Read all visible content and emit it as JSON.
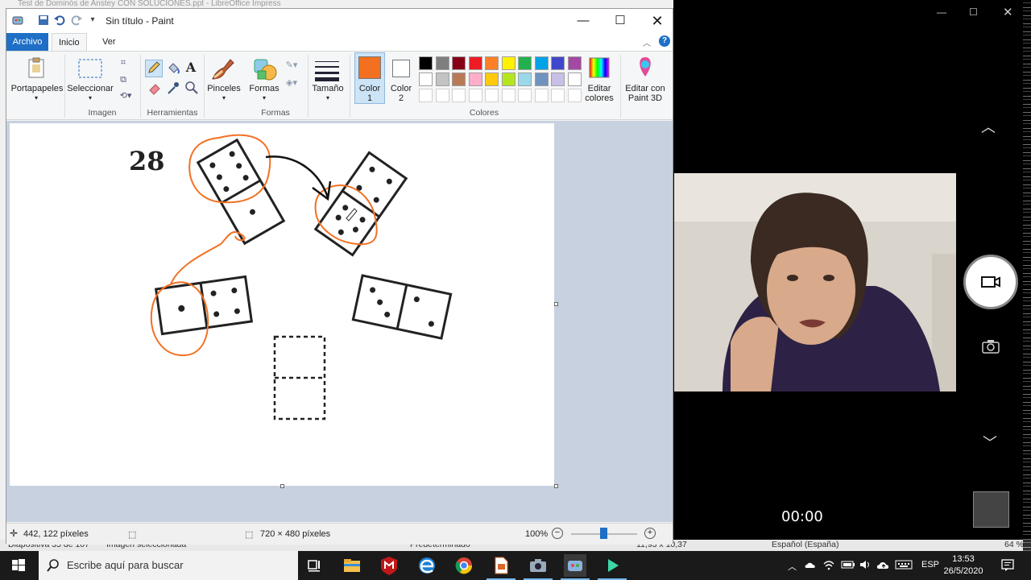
{
  "background": {
    "title": "Test de Dominós de Anstey CON SOLUCIONES.ppt - LibreOffice Impress",
    "status": {
      "slide": "Diapositiva 35 de 107",
      "selection": "Imagen seleccionada",
      "default": "Predeterminado",
      "coords": "11,93 x 10,37",
      "lang": "Español (España)",
      "zoom": "64 %"
    }
  },
  "paint": {
    "title": "Sin título - Paint",
    "tabs": {
      "file": "Archivo",
      "home": "Inicio",
      "view": "Ver"
    },
    "groups": {
      "clipboard": "Portapapeles",
      "select": "Seleccionar",
      "image": "Imagen",
      "tools": "Herramientas",
      "brushes": "Pinceles",
      "shapes": "Formas",
      "size": "Tamaño",
      "color1": [
        "Color",
        "1"
      ],
      "color2": [
        "Color",
        "2"
      ],
      "edit_colors": [
        "Editar",
        "colores"
      ],
      "paint3d": [
        "Editar con",
        "Paint 3D"
      ],
      "colors": "Colores",
      "shapes_group": "Formas"
    },
    "color1_value": "#f37021",
    "color2_value": "#ffffff",
    "palette_row1": [
      "#000000",
      "#7f7f7f",
      "#880015",
      "#ed1c24",
      "#ff7f27",
      "#fff200",
      "#22b14c",
      "#00a2e8",
      "#3f48cc",
      "#a349a4"
    ],
    "palette_row2": [
      "#ffffff",
      "#c3c3c3",
      "#b97a57",
      "#ffaec9",
      "#ffc90e",
      "#b5e61d",
      "#99d9ea",
      "#7092be",
      "#c8bfe7",
      "#ffffff"
    ],
    "canvas": {
      "puzzle_number": "28"
    },
    "status": {
      "cursor_pos": "442, 122 píxeles",
      "image_size": "720 × 480 píxeles",
      "zoom": "100%",
      "zoom_level": 0.5
    }
  },
  "camera": {
    "timer": "00:00"
  },
  "taskbar": {
    "search_placeholder": "Escribe aquí para buscar",
    "lang": "ESP",
    "time": "13:53",
    "date": "26/5/2020"
  }
}
